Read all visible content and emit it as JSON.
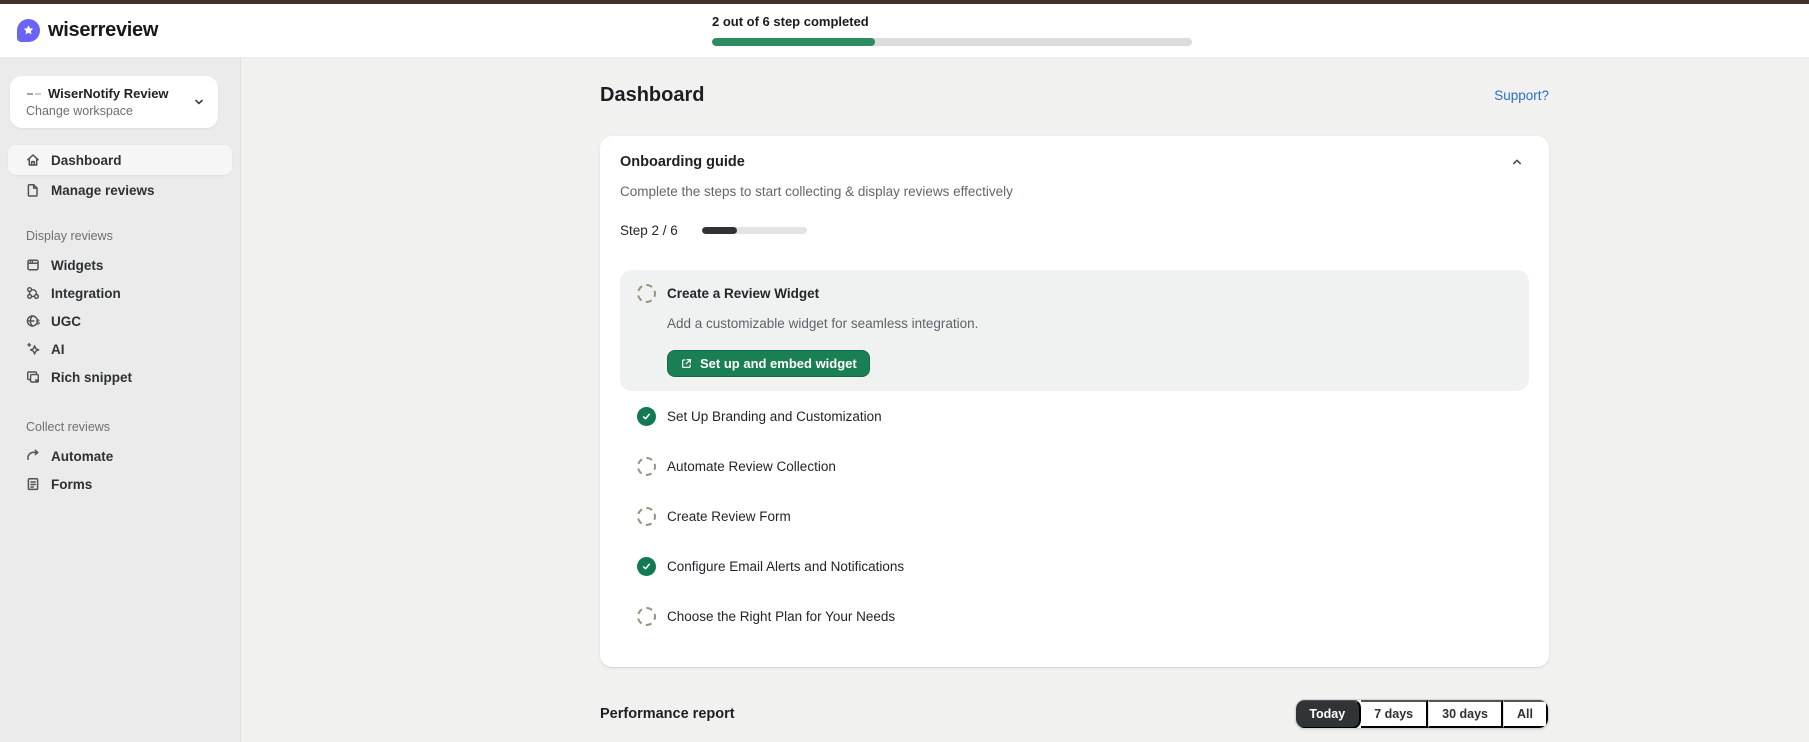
{
  "header": {
    "brand": "wiserreview",
    "progress": {
      "label": "2 out of 6 step completed",
      "percent": 34
    }
  },
  "sidebar": {
    "workspace": {
      "name": "WiserNotify Review",
      "subtitle": "Change workspace"
    },
    "nav_top": [
      {
        "label": "Dashboard",
        "state": "active"
      },
      {
        "label": "Manage reviews",
        "state": "inactive"
      }
    ],
    "sections": [
      {
        "title": "Display reviews",
        "items": [
          {
            "label": "Widgets"
          },
          {
            "label": "Integration"
          },
          {
            "label": "UGC"
          },
          {
            "label": "AI"
          },
          {
            "label": "Rich snippet"
          }
        ]
      },
      {
        "title": "Collect reviews",
        "items": [
          {
            "label": "Automate"
          },
          {
            "label": "Forms"
          }
        ]
      }
    ]
  },
  "main": {
    "title": "Dashboard",
    "support_link": "Support?",
    "onboarding": {
      "title": "Onboarding guide",
      "subtitle": "Complete the steps to start collecting & display reviews effectively",
      "step_label": "Step 2 / 6",
      "progress_percent": 34,
      "current_step": {
        "title": "Create a Review Widget",
        "description": "Add a customizable widget for seamless integration.",
        "button_label": "Set up and embed widget"
      },
      "steps": [
        {
          "title": "Set Up Branding and Customization",
          "state": "done"
        },
        {
          "title": "Automate Review Collection",
          "state": "pending"
        },
        {
          "title": "Create Review Form",
          "state": "pending"
        },
        {
          "title": "Configure Email Alerts and Notifications",
          "state": "done"
        },
        {
          "title": "Choose the Right Plan for Your Needs",
          "state": "pending"
        }
      ]
    },
    "performance": {
      "title": "Performance report",
      "filters": [
        {
          "label": "Today",
          "state": "active"
        },
        {
          "label": "7 days",
          "state": "inactive"
        },
        {
          "label": "30 days",
          "state": "inactive"
        },
        {
          "label": "All",
          "state": "inactive"
        }
      ]
    }
  },
  "colors": {
    "brand_purple": "#6a63f6",
    "top_strip_brown": "#45302b",
    "header_progress_green": "#2e8b61",
    "button_green": "#1a7f52",
    "check_green": "#127a53",
    "link_blue": "#2c6ecb",
    "active_filter_dark": "#313437"
  }
}
